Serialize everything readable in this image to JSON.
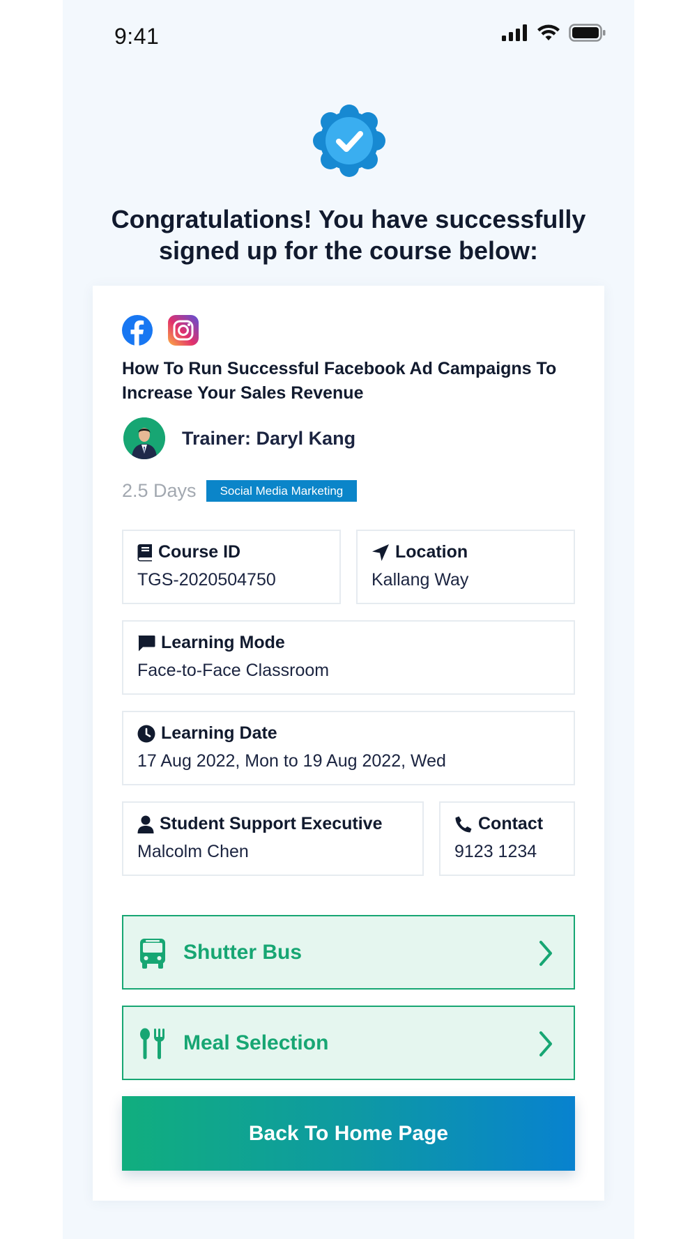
{
  "status_bar": {
    "time": "9:41"
  },
  "headline": "Congratulations! You have successfully signed up for the course below:",
  "course": {
    "title": "How To Run Successful Facebook Ad Campaigns To Increase Your Sales Revenue",
    "trainer": "Trainer: Daryl Kang",
    "duration": "2.5 Days",
    "category": "Social Media Marketing"
  },
  "details": {
    "course_id": {
      "label": "Course ID",
      "value": "TGS-2020504750"
    },
    "location": {
      "label": "Location",
      "value": "Kallang Way"
    },
    "learning_mode": {
      "label": "Learning Mode",
      "value": "Face-to-Face Classroom"
    },
    "learning_date": {
      "label": "Learning Date",
      "value": "17 Aug 2022, Mon to 19 Aug 2022, Wed"
    },
    "support": {
      "label": "Student Support Executive",
      "value": "Malcolm Chen"
    },
    "contact": {
      "label": "Contact",
      "value": "9123 1234"
    }
  },
  "actions": {
    "shuttle_bus": "Shutter Bus",
    "meal_selection": "Meal Selection",
    "back_home": "Back To Home Page"
  },
  "icons": [
    "facebook-icon",
    "instagram-icon",
    "verified-badge-icon",
    "book-icon",
    "location-arrow-icon",
    "chat-icon",
    "clock-icon",
    "user-icon",
    "phone-icon",
    "bus-icon",
    "utensils-icon",
    "chevron-right-icon"
  ],
  "colors": {
    "primary_blue": "#0b85c9",
    "green": "#17a673",
    "green_bg": "#e5f6ef",
    "text_dark": "#111a2e",
    "muted": "#a2a8b0"
  }
}
